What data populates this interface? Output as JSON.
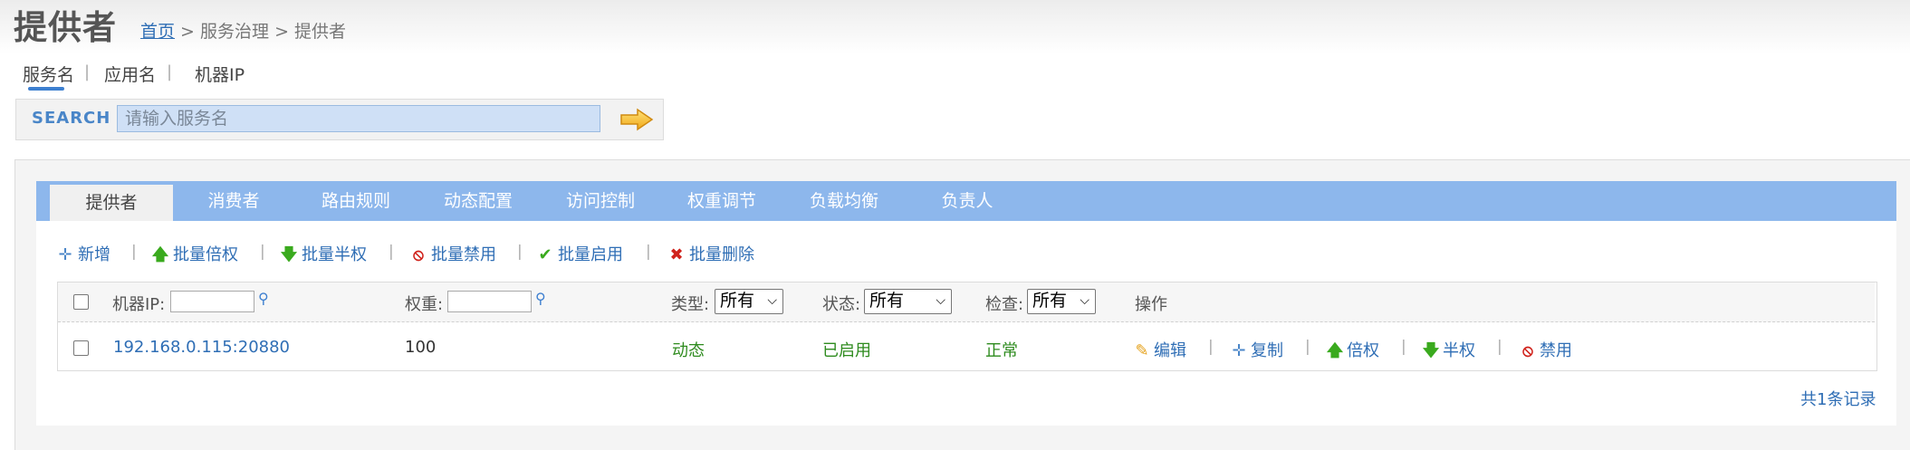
{
  "header": {
    "title": "提供者",
    "breadcrumb": {
      "home": "首页",
      "sep1": " > ",
      "section": "服务治理",
      "sep2": " > ",
      "current": "提供者"
    }
  },
  "search": {
    "types": [
      "服务名",
      "应用名",
      "机器IP"
    ],
    "label": "SEARCH",
    "placeholder": "请输入服务名"
  },
  "tabs": [
    "提供者",
    "消费者",
    "路由规则",
    "动态配置",
    "访问控制",
    "权重调节",
    "负载均衡",
    "负责人"
  ],
  "toolbar": [
    "新增",
    "批量倍权",
    "批量半权",
    "批量禁用",
    "批量启用",
    "批量删除"
  ],
  "table": {
    "filters": {
      "ip_label": "机器IP:",
      "weight_label": "权重:",
      "type_label": "类型:",
      "type_value": "所有",
      "status_label": "状态:",
      "status_value": "所有",
      "check_label": "检查:",
      "check_value": "所有",
      "ops_label": "操作"
    },
    "rows": [
      {
        "ip": "192.168.0.115:20880",
        "weight": "100",
        "type": "动态",
        "status": "已启用",
        "check": "正常"
      }
    ],
    "row_actions": [
      "编辑",
      "复制",
      "倍权",
      "半权",
      "禁用"
    ],
    "total": "共1条记录"
  },
  "colors": {
    "tab_bar": "#8db7ec",
    "link": "#2f6eb5",
    "ok_green": "#2e8b1e",
    "delete_red": "#d0221b"
  }
}
